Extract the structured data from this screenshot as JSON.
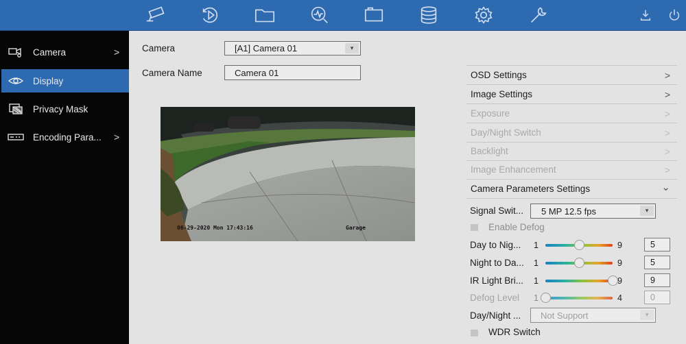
{
  "toolbar": {
    "icons": [
      "cctv-camera-icon",
      "playback-icon",
      "folder-icon",
      "search-analytics-icon",
      "camera-config-icon",
      "storage-database-icon",
      "settings-gear-icon",
      "maintenance-wrench-icon"
    ],
    "right_icons": [
      "download-icon",
      "power-icon"
    ]
  },
  "sidebar": {
    "items": [
      {
        "label": "Camera",
        "icon": "camera-icon",
        "has_arrow": true
      },
      {
        "label": "Display",
        "icon": "eye-icon",
        "active": true
      },
      {
        "label": "Privacy Mask",
        "icon": "privacy-mask-icon"
      },
      {
        "label": "Encoding Para...",
        "icon": "encoding-icon",
        "has_arrow": true
      }
    ],
    "arrow": ">"
  },
  "form": {
    "camera_label": "Camera",
    "camera_value": "[A1] Camera 01",
    "camera_name_label": "Camera Name",
    "camera_name_value": "Camera 01"
  },
  "preview": {
    "timestamp": "06-29-2020 Mon 17:43:16",
    "channel_name": "Garage"
  },
  "panel": {
    "sections": [
      {
        "label": "OSD Settings",
        "chevron": ">",
        "enabled": true
      },
      {
        "label": "Image Settings",
        "chevron": ">",
        "enabled": true
      },
      {
        "label": "Exposure",
        "chevron": ">",
        "enabled": false
      },
      {
        "label": "Day/Night Switch",
        "chevron": ">",
        "enabled": false
      },
      {
        "label": "Backlight",
        "chevron": ">",
        "enabled": false
      },
      {
        "label": "Image Enhancement",
        "chevron": ">",
        "enabled": false
      },
      {
        "label": "Camera Parameters Settings",
        "chevron": "⌄",
        "enabled": true,
        "expanded": true
      }
    ],
    "signal_switch": {
      "label": "Signal Swit...",
      "value": "5 MP 12.5 fps"
    },
    "enable_defog": {
      "label": "Enable Defog",
      "checked": false
    },
    "sliders": [
      {
        "label": "Day to Nig...",
        "min": "1",
        "max": "9",
        "value": "5",
        "fraction": 0.5,
        "enabled": true
      },
      {
        "label": "Night to Da...",
        "min": "1",
        "max": "9",
        "value": "5",
        "fraction": 0.5,
        "enabled": true
      },
      {
        "label": "IR Light Bri...",
        "min": "1",
        "max": "9",
        "value": "9",
        "fraction": 1.0,
        "enabled": true
      },
      {
        "label": "Defog Level",
        "min": "1",
        "max": "4",
        "value": "0",
        "fraction": 0.0,
        "enabled": false
      }
    ],
    "day_night": {
      "label": "Day/Night ...",
      "value": "Not Support",
      "enabled": false
    },
    "wdr_switch": {
      "label": "WDR Switch",
      "checked": false
    }
  },
  "colors": {
    "accent": "#2e6ab0",
    "sidebar_bg": "#060606",
    "content_bg": "#e3e3e3"
  }
}
